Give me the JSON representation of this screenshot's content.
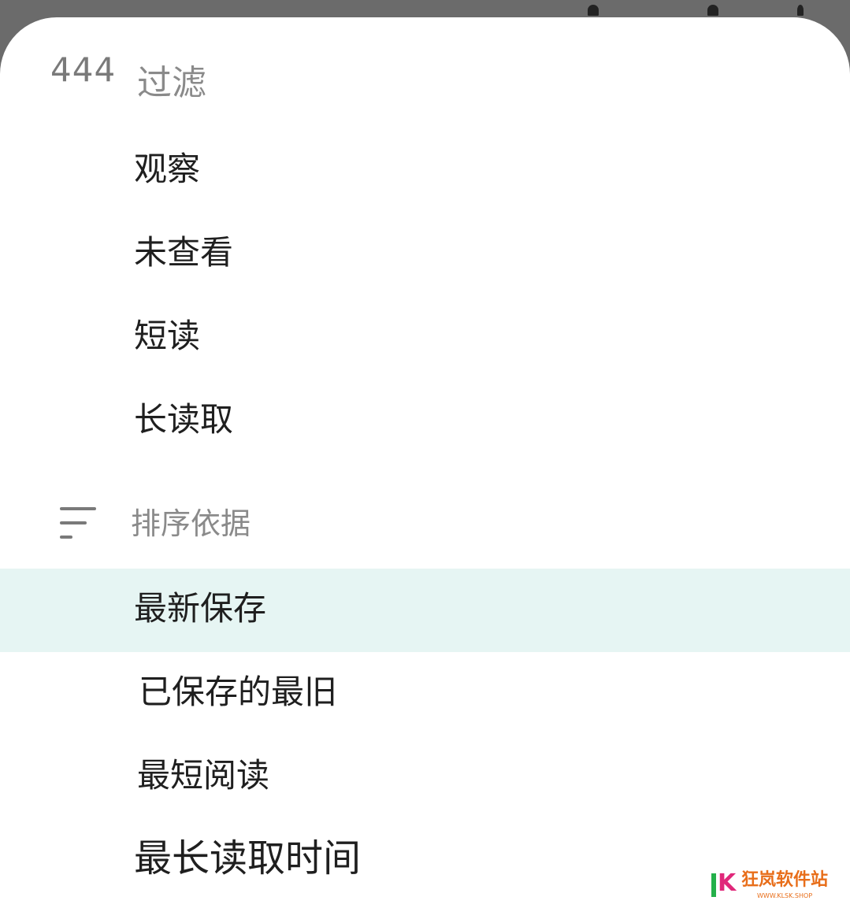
{
  "filter": {
    "icon_text": "444",
    "icon": "filter-count-icon",
    "title": "过滤",
    "items": [
      {
        "label": "观察"
      },
      {
        "label": "未查看"
      },
      {
        "label": "短读"
      },
      {
        "label": "长读取"
      }
    ]
  },
  "sort": {
    "icon": "sort-icon",
    "title": "排序依据",
    "items": [
      {
        "label": "最新保存",
        "selected": true
      },
      {
        "label": "已保存的最旧"
      },
      {
        "label": "最短阅读"
      },
      {
        "label": "最长读取时间"
      }
    ]
  },
  "watermark": {
    "k": "K",
    "name": "狂岚软件站",
    "sub": "WWW.KLSK.SHOP"
  },
  "colors": {
    "selected_bg": "#e6f5f3",
    "header_text": "#8a8a8a",
    "item_text": "#1f1f1f"
  }
}
